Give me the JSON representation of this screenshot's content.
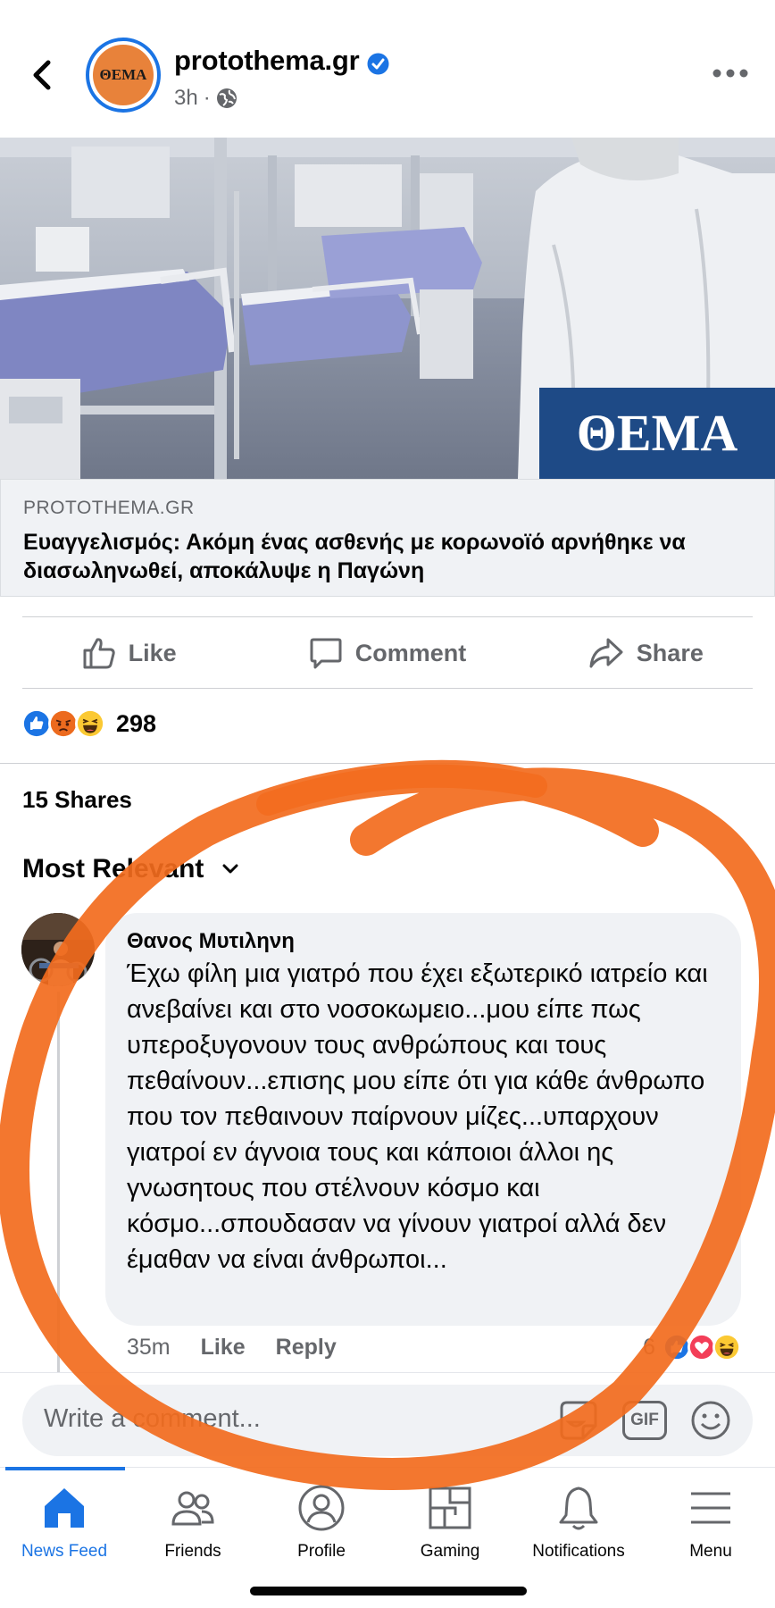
{
  "header": {
    "page_name": "protothema.gr",
    "page_avatar_text": "ΘΕΜΑ",
    "time": "3h",
    "dot": "·",
    "verified_icon": "verified-badge-icon",
    "audience_icon": "globe-icon"
  },
  "post": {
    "image_logo_text": "ΘΕΜΑ",
    "link_domain": "PROTOTHEMA.GR",
    "link_title": "Ευαγγελισμός: Ακόμη ένας ασθενής με κορωνοϊό αρνήθηκε να διασωληνωθεί, αποκάλυψε η Παγώνη"
  },
  "actions": {
    "like": "Like",
    "comment": "Comment",
    "share": "Share"
  },
  "reactions": {
    "count": "298",
    "types": [
      "like",
      "angry",
      "haha"
    ]
  },
  "shares": "15 Shares",
  "sort": {
    "label": "Most Relevant"
  },
  "comment": {
    "author": "Θανος Μυτιληνη",
    "text": "Έχω φίλη μια γιατρό που έχει εξωτερικό ιατρείο και ανεβαίνει και στο νοσοκωμειο...μου είπε πως υπεροξυγονουν τους ανθρώπους και τους πεθαίνουν...επισης μου είπε ότι για κάθε άνθρωπο που τον πεθαινουν παίρνουν μίζες...υπαρχουν γιατροί εν άγνοια τους και κάποιοι άλλοι ης γνωσητους που στέλνουν κόσμο και κόσμο...σπουδασαν να γίνουν γιατροί αλλά δεν έμαθαν να είναι άνθρωποι...",
    "time": "35m",
    "like": "Like",
    "reply": "Reply",
    "reaction_count": "6",
    "reaction_types": [
      "like",
      "love",
      "haha"
    ]
  },
  "composer": {
    "placeholder": "Write a comment...",
    "gif": "GIF"
  },
  "tabbar": {
    "tabs": [
      {
        "label": "News Feed",
        "icon": "home-icon",
        "active": true
      },
      {
        "label": "Friends",
        "icon": "friends-icon",
        "active": false
      },
      {
        "label": "Profile",
        "icon": "profile-icon",
        "active": false
      },
      {
        "label": "Gaming",
        "icon": "gaming-icon",
        "active": false
      },
      {
        "label": "Notifications",
        "icon": "bell-icon",
        "active": false
      },
      {
        "label": "Menu",
        "icon": "menu-icon",
        "active": false
      }
    ]
  },
  "colors": {
    "accent": "#1b74e4",
    "secondary_text": "#65676b",
    "bubble": "#f0f2f5",
    "scribble": "#f26b1d"
  }
}
